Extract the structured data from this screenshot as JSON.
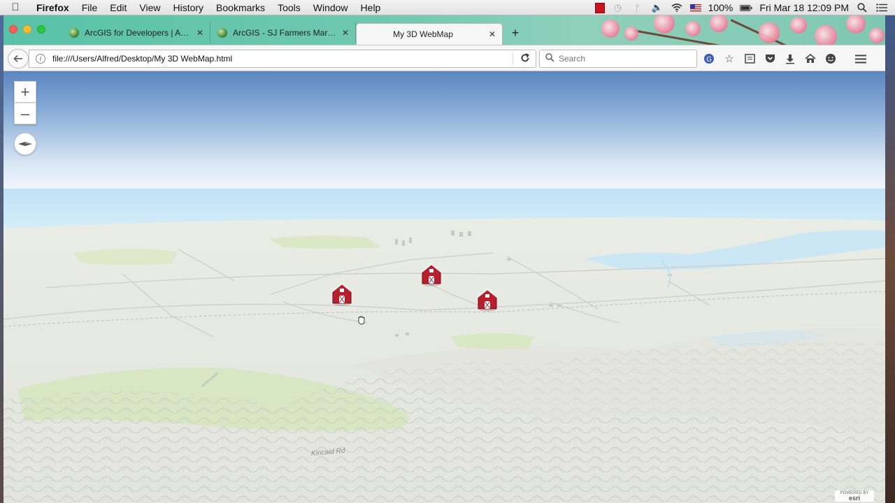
{
  "menubar": {
    "app_name": "Firefox",
    "menus": [
      "File",
      "Edit",
      "View",
      "History",
      "Bookmarks",
      "Tools",
      "Window",
      "Help"
    ],
    "battery": "100%",
    "datetime": "Fri Mar 18  12:09 PM",
    "tray_icons": [
      "red-square-icon",
      "time-machine-icon",
      "bluetooth-icon",
      "volume-icon",
      "wifi-icon",
      "us-flag-icon",
      "battery-icon",
      "spotlight-icon",
      "notification-center-icon"
    ]
  },
  "browser": {
    "tabs": [
      {
        "label": "ArcGIS for Developers | Arc...",
        "active": false
      },
      {
        "label": "ArcGIS - SJ Farmers Marke...",
        "active": false
      },
      {
        "label": "My 3D WebMap",
        "active": true
      }
    ],
    "url": "file:///Users/Alfred/Desktop/My 3D WebMap.html",
    "search_placeholder": "Search"
  },
  "map": {
    "zoom_in": "+",
    "zoom_out": "–",
    "markers": [
      "farmers-market-pin-1",
      "farmers-market-pin-2",
      "farmers-market-pin-3"
    ],
    "labels": [
      "Kincaid Rd"
    ],
    "attribution": {
      "top": "POWERED BY",
      "brand": "esri"
    }
  }
}
